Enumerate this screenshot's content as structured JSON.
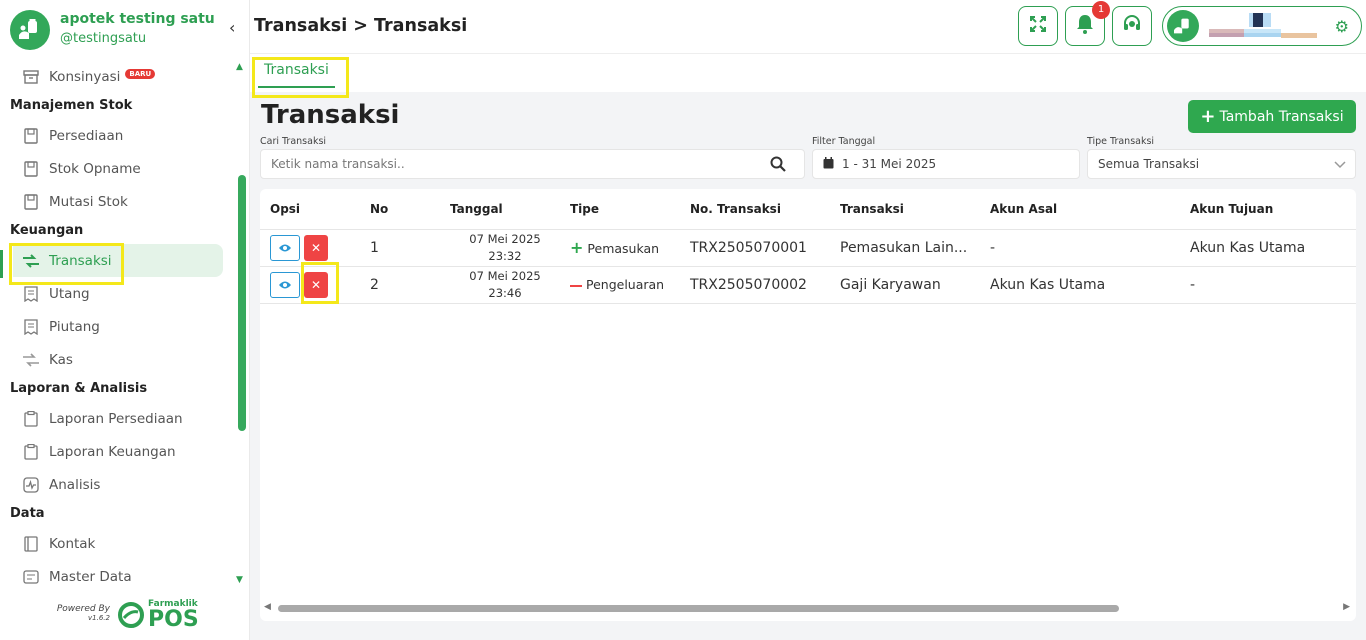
{
  "brand": {
    "name": "apotek testing satu",
    "username": "@testingsatu"
  },
  "sidebar": {
    "konsinyasi": {
      "label": "Konsinyasi",
      "badge": "BARU"
    },
    "sections": {
      "stok": "Manajemen Stok",
      "keuangan": "Keuangan",
      "laporan": "Laporan & Analisis",
      "data": "Data"
    },
    "items": {
      "persediaan": "Persediaan",
      "stok_opname": "Stok Opname",
      "mutasi_stok": "Mutasi Stok",
      "transaksi": "Transaksi",
      "utang": "Utang",
      "piutang": "Piutang",
      "kas": "Kas",
      "laporan_persediaan": "Laporan Persediaan",
      "laporan_keuangan": "Laporan Keuangan",
      "analisis": "Analisis",
      "kontak": "Kontak",
      "master_data": "Master Data"
    }
  },
  "footer": {
    "powered_by": "Powered By",
    "version": "v1.6.2",
    "logo_top": "Farmaklik",
    "logo_bottom": "POS"
  },
  "header": {
    "title": "Transaksi > Transaksi",
    "notification_count": "1"
  },
  "tabs": [
    {
      "label": "Transaksi"
    }
  ],
  "main": {
    "title": "Transaksi",
    "add_button": "Tambah Transaksi",
    "search": {
      "label": "Cari Transaksi",
      "placeholder": "Ketik nama transaksi.."
    },
    "date_filter": {
      "label": "Filter Tanggal",
      "value": "1 - 31 Mei 2025"
    },
    "type_filter": {
      "label": "Tipe Transaksi",
      "value": "Semua Transaksi"
    }
  },
  "table": {
    "columns": [
      "Opsi",
      "No",
      "Tanggal",
      "Tipe",
      "No. Transaksi",
      "Transaksi",
      "Akun Asal",
      "Akun Tujuan"
    ],
    "rows": [
      {
        "no": "1",
        "date": "07 Mei 2025",
        "time": "23:32",
        "type": "Pemasukan",
        "trx_no": "TRX2505070001",
        "trx": "Pemasukan Lain...",
        "from": "-",
        "to": "Akun Kas Utama"
      },
      {
        "no": "2",
        "date": "07 Mei 2025",
        "time": "23:46",
        "type": "Pengeluaran",
        "trx_no": "TRX2505070002",
        "trx": "Gaji Karyawan",
        "from": "Akun Kas Utama",
        "to": "-"
      }
    ]
  },
  "colors": {
    "accent": "#2e9f52",
    "danger": "#ef4444",
    "info": "#2a97d4",
    "highlight": "#f4e81a"
  }
}
